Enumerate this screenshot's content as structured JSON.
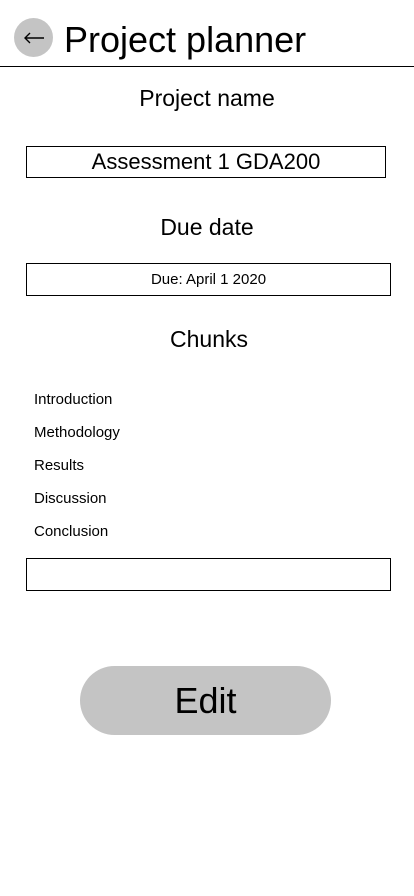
{
  "header": {
    "back_icon": "arrow-left-icon",
    "title": "Project planner"
  },
  "project_name": {
    "label": "Project name",
    "value": "Assessment 1 GDA200"
  },
  "due_date": {
    "label": "Due date",
    "value": "Due: April 1 2020"
  },
  "chunks": {
    "label": "Chunks",
    "items": [
      "Introduction",
      "Methodology",
      "Results",
      "Discussion",
      "Conclusion"
    ],
    "new_chunk_value": ""
  },
  "edit_button": {
    "label": "Edit"
  },
  "colors": {
    "button_fill": "#c4c4c4",
    "border": "#000000",
    "background": "#ffffff"
  }
}
